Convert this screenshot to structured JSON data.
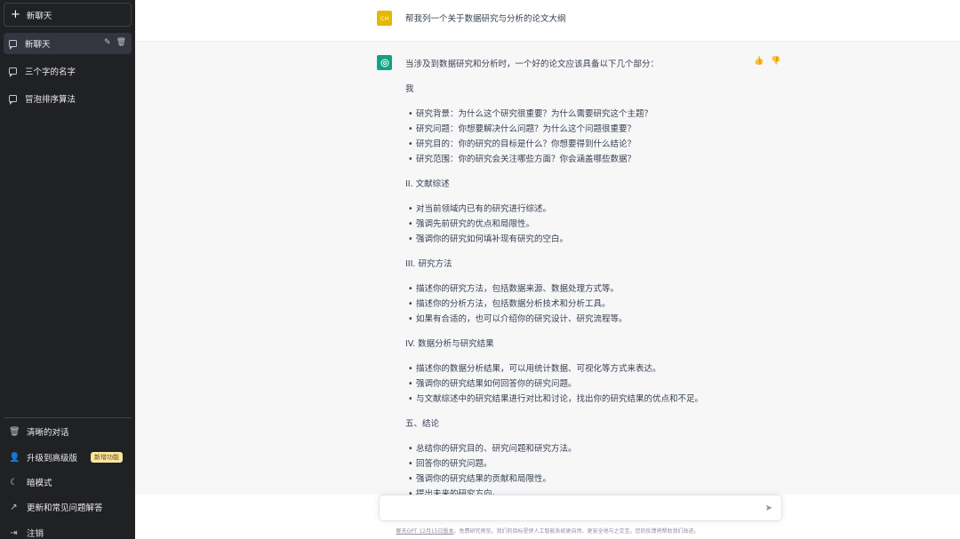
{
  "sidebar": {
    "new_chat": "新聊天",
    "chats": [
      {
        "label": "新聊天",
        "active": true
      },
      {
        "label": "三个字的名字",
        "active": false
      },
      {
        "label": "冒泡排序算法",
        "active": false
      }
    ],
    "bottom": [
      {
        "label": "清晰的对话",
        "icon": "trash-icon"
      },
      {
        "label": "升级到高级版",
        "icon": "user-icon",
        "badge": "新增功能"
      },
      {
        "label": "暗模式",
        "icon": "moon-icon"
      },
      {
        "label": "更新和常见问题解答",
        "icon": "external-link-icon"
      },
      {
        "label": "注销",
        "icon": "logout-icon"
      }
    ]
  },
  "conversation": {
    "user_initials": "CH",
    "user_message": "帮我列一个关于数据研究与分析的论文大纲",
    "assistant_lines": [
      {
        "type": "text",
        "text": "当涉及到数据研究和分析时，一个好的论文应该具备以下几个部分："
      },
      {
        "type": "gap"
      },
      {
        "type": "text",
        "text": "我"
      },
      {
        "type": "gap"
      },
      {
        "type": "bullet",
        "text": "研究背景：为什么这个研究很重要？为什么需要研究这个主题？"
      },
      {
        "type": "bullet",
        "text": "研究问题：你想要解决什么问题？为什么这个问题很重要？"
      },
      {
        "type": "bullet",
        "text": "研究目的：你的研究的目标是什么？你想要得到什么结论？"
      },
      {
        "type": "bullet",
        "text": "研究范围：你的研究会关注哪些方面？你会涵盖哪些数据？"
      },
      {
        "type": "gap"
      },
      {
        "type": "text",
        "text": "II. 文献综述"
      },
      {
        "type": "gap"
      },
      {
        "type": "bullet",
        "text": "对当前领域内已有的研究进行综述。"
      },
      {
        "type": "bullet",
        "text": "强调先前研究的优点和局限性。"
      },
      {
        "type": "bullet",
        "text": "强调你的研究如何填补现有研究的空白。"
      },
      {
        "type": "gap"
      },
      {
        "type": "text",
        "text": "III. 研究方法"
      },
      {
        "type": "gap"
      },
      {
        "type": "bullet",
        "text": "描述你的研究方法，包括数据来源、数据处理方式等。"
      },
      {
        "type": "bullet",
        "text": "描述你的分析方法，包括数据分析技术和分析工具。"
      },
      {
        "type": "bullet",
        "text": "如果有合适的，也可以介绍你的研究设计、研究流程等。"
      },
      {
        "type": "gap"
      },
      {
        "type": "text",
        "text": "IV. 数据分析与研究结果"
      },
      {
        "type": "gap"
      },
      {
        "type": "bullet",
        "text": "描述你的数据分析结果，可以用统计数据、可视化等方式来表达。"
      },
      {
        "type": "bullet",
        "text": "强调你的研究结果如何回答你的研究问题。"
      },
      {
        "type": "bullet",
        "text": "与文献综述中的研究结果进行对比和讨论，找出你的研究结果的优点和不足。"
      },
      {
        "type": "gap"
      },
      {
        "type": "text",
        "text": "五、结论"
      },
      {
        "type": "gap"
      },
      {
        "type": "bullet",
        "text": "总结你的研究目的、研究问题和研究方法。"
      },
      {
        "type": "bullet",
        "text": "回答你的研究问题。"
      },
      {
        "type": "bullet",
        "text": "强调你的研究结果的贡献和局限性。"
      },
      {
        "type": "bullet",
        "text": "提出未来的研究方向。"
      }
    ]
  },
  "footer": {
    "link": "聊天GPT 12月15日版本",
    "text": "。免费研究预览。我们的目标是使人工智能系统更自然、更安全地与之交互。您的反馈将帮助我们改进。"
  },
  "colors": {
    "sidebar_bg": "#202123",
    "assistant_bg": "#f7f7f8",
    "openai_green": "#10a37f",
    "user_avatar": "#e6b800"
  }
}
